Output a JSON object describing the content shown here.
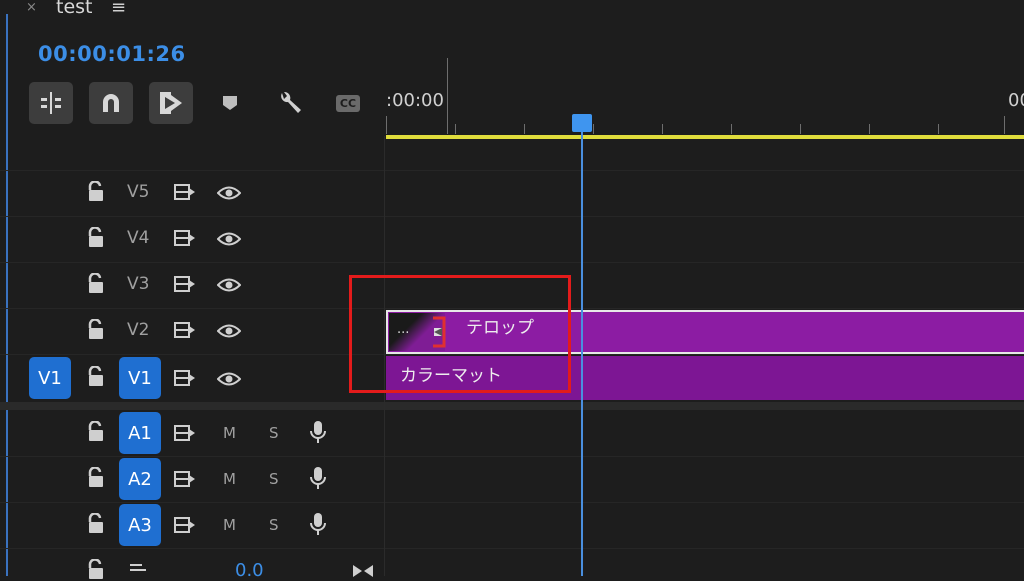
{
  "panel": {
    "close_glyph": "×",
    "title": "test",
    "menu_glyph": "≡"
  },
  "timecode": "00:00:01:26",
  "toolbar": {
    "buttons": [
      {
        "name": "insert-overwrite-icon"
      },
      {
        "name": "snap-magnet-icon"
      },
      {
        "name": "linked-selection-icon"
      },
      {
        "name": "add-marker-icon"
      },
      {
        "name": "wrench-settings-icon"
      },
      {
        "name": "captions-cc-icon",
        "label": "CC"
      }
    ]
  },
  "ruler": {
    "start_label": ":00:00",
    "end_label": "00"
  },
  "tracks": {
    "video": [
      {
        "label": "V5"
      },
      {
        "label": "V4"
      },
      {
        "label": "V3"
      },
      {
        "label": "V2"
      },
      {
        "label": "V1",
        "source_label": "V1"
      }
    ],
    "audio": [
      {
        "label": "A1",
        "m": "M",
        "s": "S"
      },
      {
        "label": "A2",
        "m": "M",
        "s": "S"
      },
      {
        "label": "A3",
        "m": "M",
        "s": "S"
      }
    ],
    "master_value": "0.0"
  },
  "clips": {
    "telop": {
      "label": "テロップ",
      "thumb_dots": "..."
    },
    "color_matte": {
      "label": "カラーマット"
    }
  },
  "colors": {
    "accent_blue": "#1f6fd1",
    "clip_purple": "#8c1ca3",
    "work_area_yellow": "#e0dd3c",
    "highlight_red": "#e31b1b"
  }
}
